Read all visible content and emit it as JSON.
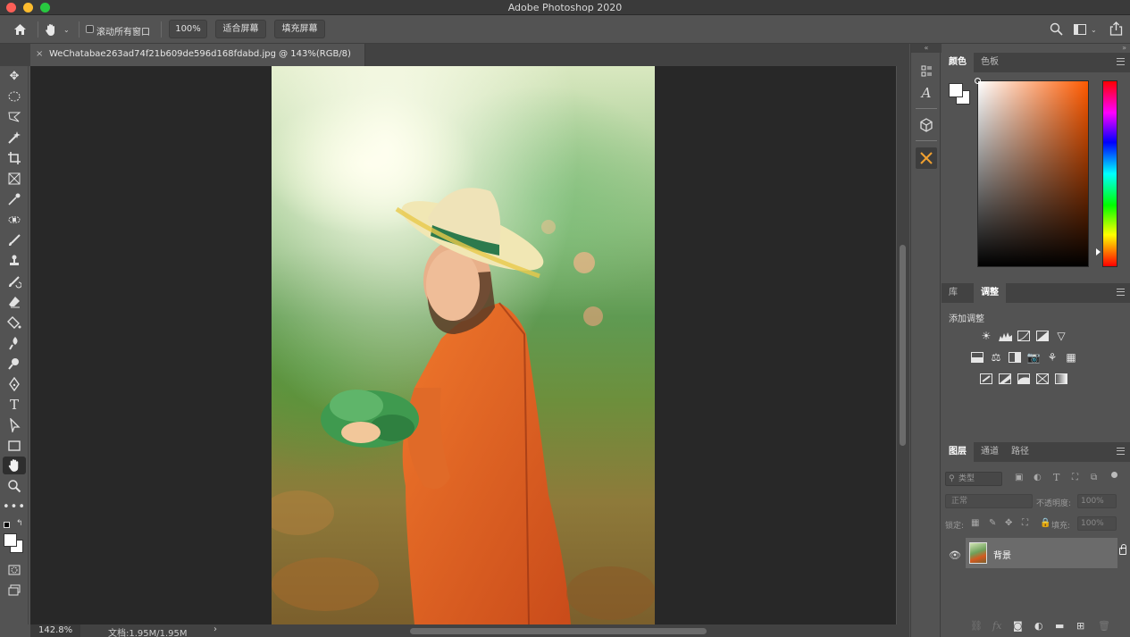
{
  "app": {
    "title": "Adobe Photoshop 2020"
  },
  "options_bar": {
    "scroll_all_windows_label": "滚动所有窗口",
    "zoom_100_label": "100%",
    "fit_screen_label": "适合屏幕",
    "fill_screen_label": "填充屏幕"
  },
  "document": {
    "tab_title": "WeChatabae263ad74f21b609de596d168fdabd.jpg @ 143%(RGB/8)",
    "close_glyph": "×"
  },
  "status_bar": {
    "zoom": "142.8%",
    "doc_info": "文档:1.95M/1.95M",
    "arrow": "›"
  },
  "color_panel": {
    "tabs": [
      "颜色",
      "色板"
    ],
    "selected_tab": "颜色",
    "foreground_color": "#ffffff",
    "background_color": "#ffffff",
    "hue_color": "#ff5a00"
  },
  "adjustments_panel": {
    "tabs": [
      "库",
      "调整"
    ],
    "selected_tab": "调整",
    "title": "添加调整"
  },
  "layers_panel": {
    "tabs": [
      "图层",
      "通道",
      "路径"
    ],
    "selected_tab": "图层",
    "filter_placeholder": "类型",
    "blend_mode": "正常",
    "opacity_label": "不透明度:",
    "opacity_value": "100%",
    "lock_label": "锁定:",
    "fill_label": "填充:",
    "fill_value": "100%",
    "layers": [
      {
        "name": "背景",
        "visible": true,
        "locked": true
      }
    ]
  }
}
